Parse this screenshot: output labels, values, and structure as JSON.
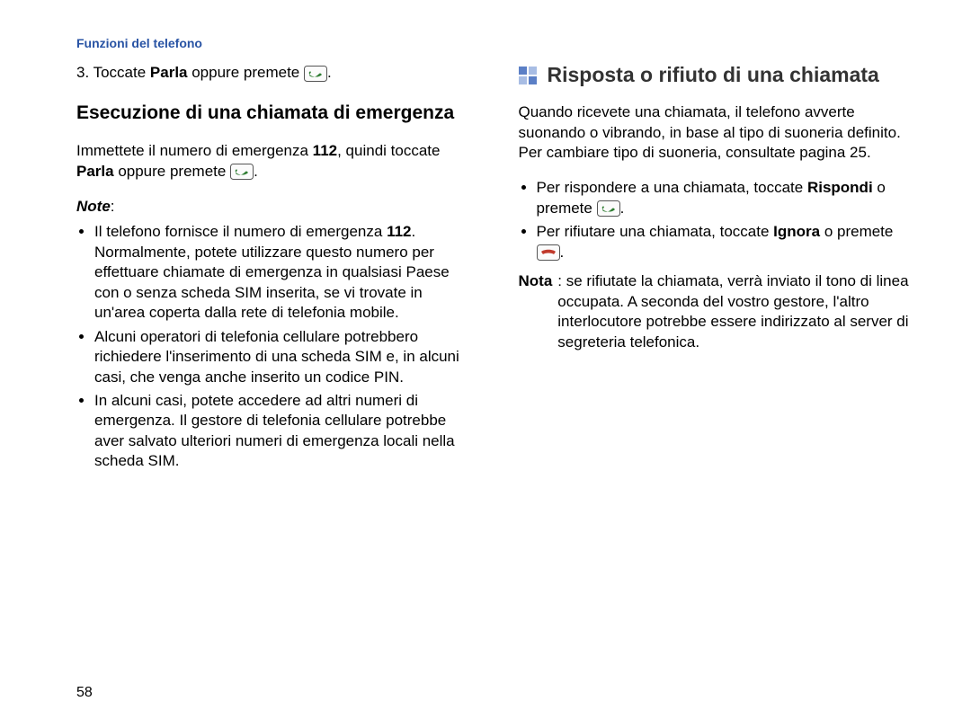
{
  "header": "Funzioni del telefono",
  "left": {
    "step3_pre": "3. Toccate ",
    "step3_bold": "Parla",
    "step3_mid": " oppure premete ",
    "step3_post": ".",
    "subhead": "Esecuzione di una chiamata di emergenza",
    "intro_pre": "Immettete il numero di emergenza ",
    "intro_b1": "112",
    "intro_mid": ", quindi toccate ",
    "intro_b2": "Parla",
    "intro_mid2": " oppure premete ",
    "intro_post": ".",
    "note_label": "Note",
    "note_colon": ":",
    "bullets": [
      {
        "pre": "Il telefono fornisce il numero di emergenza ",
        "b": "112",
        "post": ". Normalmente, potete utilizzare questo numero per effettuare chiamate di emergenza in qualsiasi Paese con o senza scheda SIM inserita, se vi trovate in un'area coperta dalla rete di telefonia mobile."
      },
      {
        "pre": "",
        "b": "",
        "post": "Alcuni operatori di telefonia cellulare potrebbero richiedere l'inserimento di una scheda SIM e, in alcuni casi, che venga anche inserito un codice PIN."
      },
      {
        "pre": "",
        "b": "",
        "post": "In alcuni casi, potete accedere ad altri numeri di emergenza. Il gestore di telefonia cellulare potrebbe aver salvato ulteriori numeri di emergenza locali nella scheda SIM."
      }
    ]
  },
  "right": {
    "mainhead": "Risposta o rifiuto di una chiamata",
    "para": "Quando ricevete una chiamata, il telefono avverte suonando o vibrando, in base al tipo di suoneria definito. Per cambiare tipo di suoneria, consultate pagina 25.",
    "bullet1_pre": "Per rispondere a una chiamata, toccate ",
    "bullet1_b": "Rispondi",
    "bullet1_mid": " o premete ",
    "bullet1_post": ".",
    "bullet2_pre": "Per rifiutare una chiamata, toccate ",
    "bullet2_b": "Ignora",
    "bullet2_mid": " o premete ",
    "bullet2_post": ".",
    "nota_label": "Nota",
    "nota_body": ": se rifiutate la chiamata, verrà inviato il tono di linea occupata. A seconda del vostro gestore, l'altro interlocutore potrebbe essere indirizzato al server di segreteria telefonica."
  },
  "page_number": "58"
}
